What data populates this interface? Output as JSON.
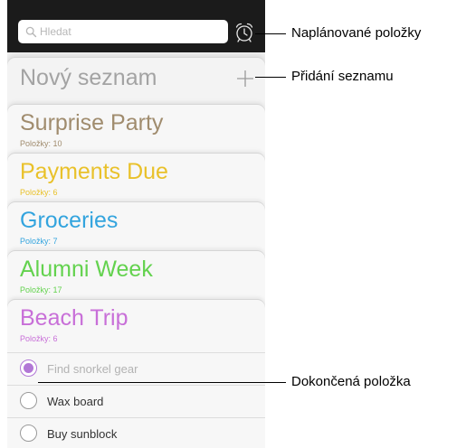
{
  "search": {
    "placeholder": "Hledat",
    "icon": "search-icon"
  },
  "toolbar": {
    "alarm_icon": "alarm-clock-icon"
  },
  "new_list": {
    "label": "Nový seznam",
    "add_icon": "plus-icon"
  },
  "lists": [
    {
      "title": "Surprise Party",
      "count": "Položky: 10",
      "color": "#a08c6e"
    },
    {
      "title": "Payments Due",
      "count": "Položky: 6",
      "color": "#e9c12a"
    },
    {
      "title": "Groceries",
      "count": "Položky: 7",
      "color": "#33a4de"
    },
    {
      "title": "Alumni Week",
      "count": "Položky: 17",
      "color": "#63d24e"
    },
    {
      "title": "Beach Trip",
      "count": "Položky: 6",
      "color": "#c86fd8"
    }
  ],
  "reminders": [
    {
      "text": "Find snorkel gear",
      "completed": true
    },
    {
      "text": "Wax board",
      "completed": false
    },
    {
      "text": "Buy sunblock",
      "completed": false
    }
  ],
  "callouts": {
    "scheduled": "Naplánované položky",
    "add_list": "Přidání seznamu",
    "completed_item": "Dokončená položka"
  }
}
